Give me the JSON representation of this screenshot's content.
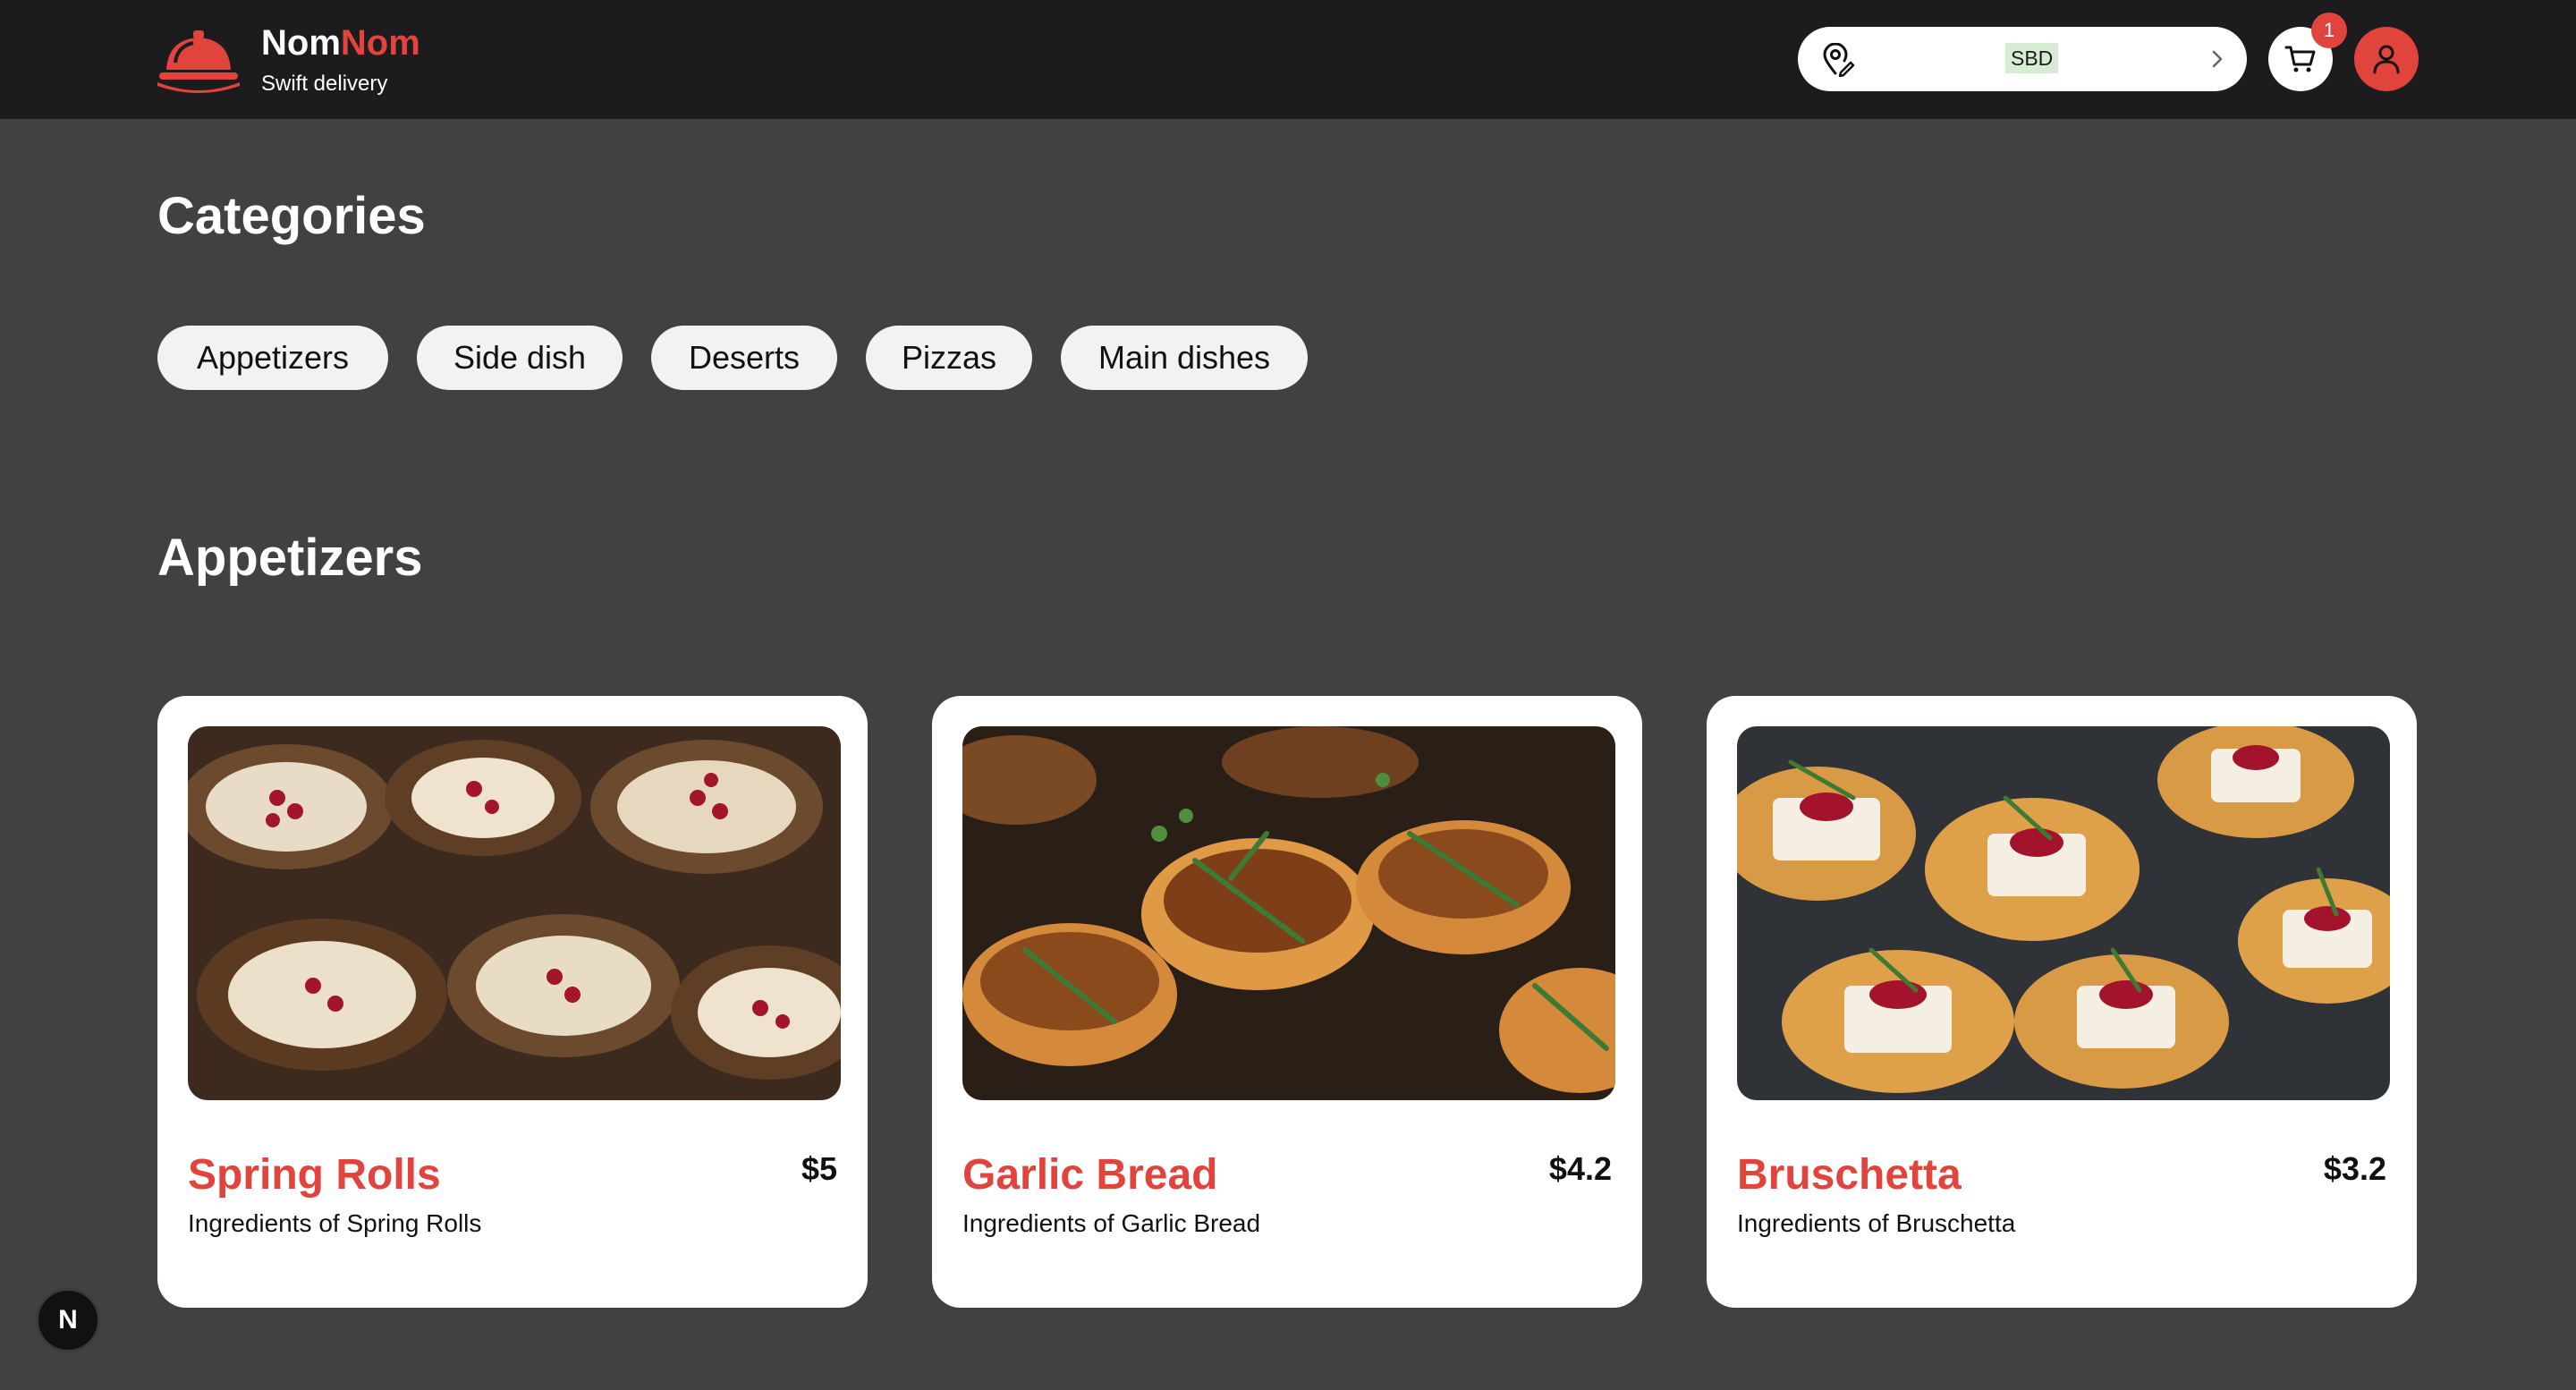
{
  "header": {
    "brand_first": "Nom",
    "brand_second": "Nom",
    "tagline": "Swift delivery",
    "currency": "SBD",
    "cart_count": "1",
    "accent_color": "#e0443c"
  },
  "categories": {
    "title": "Categories",
    "items": [
      "Appetizers",
      "Side dish",
      "Deserts",
      "Pizzas",
      "Main dishes"
    ]
  },
  "appetizers": {
    "title": "Appetizers",
    "items": [
      {
        "name": "Spring Rolls",
        "price": "$5",
        "ingredients": "Ingredients of Spring Rolls"
      },
      {
        "name": "Garlic Bread",
        "price": "$4.2",
        "ingredients": "Ingredients of Garlic Bread"
      },
      {
        "name": "Bruschetta",
        "price": "$3.2",
        "ingredients": "Ingredients of Bruschetta"
      }
    ]
  },
  "dev": {
    "badge": "N"
  },
  "icons": [
    "cloche-logo-icon",
    "location-pin-icon",
    "chevron-right-icon",
    "cart-icon",
    "user-icon"
  ]
}
